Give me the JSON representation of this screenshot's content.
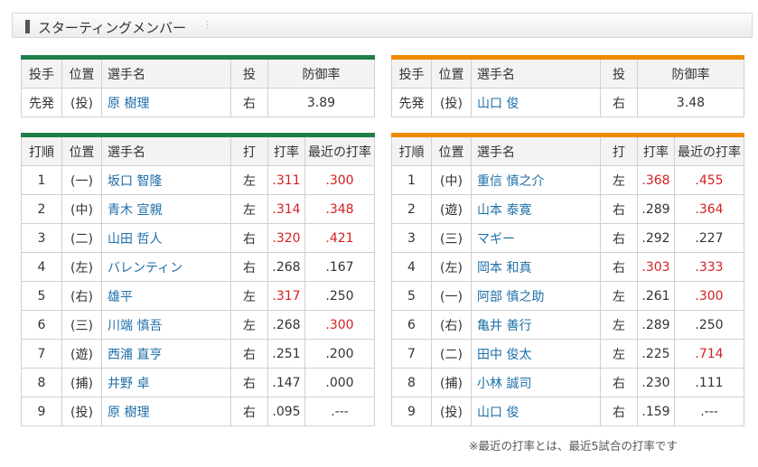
{
  "header": {
    "title": "スターティングメンバー",
    "dots": "⋮"
  },
  "pitcher_headers": [
    "投手",
    "位置",
    "選手名",
    "投",
    "防御率"
  ],
  "batter_headers": [
    "打順",
    "位置",
    "選手名",
    "打",
    "打率",
    "最近の打率"
  ],
  "left_team": {
    "color": "#1f7f4a",
    "pitcher": {
      "role": "先発",
      "pos": "(投)",
      "name": "原 樹理",
      "hand": "右",
      "era": "3.89"
    },
    "batters": [
      {
        "order": "1",
        "pos": "(一)",
        "name": "坂口 智隆",
        "hand": "左",
        "avg": ".311",
        "recent": ".300",
        "avg_red": true,
        "recent_red": true
      },
      {
        "order": "2",
        "pos": "(中)",
        "name": "青木 宣親",
        "hand": "左",
        "avg": ".314",
        "recent": ".348",
        "avg_red": true,
        "recent_red": true
      },
      {
        "order": "3",
        "pos": "(二)",
        "name": "山田 哲人",
        "hand": "右",
        "avg": ".320",
        "recent": ".421",
        "avg_red": true,
        "recent_red": true
      },
      {
        "order": "4",
        "pos": "(左)",
        "name": "バレンティン",
        "hand": "右",
        "avg": ".268",
        "recent": ".167",
        "avg_red": false,
        "recent_red": false
      },
      {
        "order": "5",
        "pos": "(右)",
        "name": "雄平",
        "hand": "左",
        "avg": ".317",
        "recent": ".250",
        "avg_red": true,
        "recent_red": false
      },
      {
        "order": "6",
        "pos": "(三)",
        "name": "川端 慎吾",
        "hand": "左",
        "avg": ".268",
        "recent": ".300",
        "avg_red": false,
        "recent_red": true
      },
      {
        "order": "7",
        "pos": "(遊)",
        "name": "西浦 直亨",
        "hand": "右",
        "avg": ".251",
        "recent": ".200",
        "avg_red": false,
        "recent_red": false
      },
      {
        "order": "8",
        "pos": "(捕)",
        "name": "井野 卓",
        "hand": "右",
        "avg": ".147",
        "recent": ".000",
        "avg_red": false,
        "recent_red": false
      },
      {
        "order": "9",
        "pos": "(投)",
        "name": "原 樹理",
        "hand": "右",
        "avg": ".095",
        "recent": ".---",
        "avg_red": false,
        "recent_red": false
      }
    ]
  },
  "right_team": {
    "color": "#f08a00",
    "pitcher": {
      "role": "先発",
      "pos": "(投)",
      "name": "山口 俊",
      "hand": "右",
      "era": "3.48"
    },
    "batters": [
      {
        "order": "1",
        "pos": "(中)",
        "name": "重信 慎之介",
        "hand": "左",
        "avg": ".368",
        "recent": ".455",
        "avg_red": true,
        "recent_red": true
      },
      {
        "order": "2",
        "pos": "(遊)",
        "name": "山本 泰寛",
        "hand": "右",
        "avg": ".289",
        "recent": ".364",
        "avg_red": false,
        "recent_red": true
      },
      {
        "order": "3",
        "pos": "(三)",
        "name": "マギー",
        "hand": "右",
        "avg": ".292",
        "recent": ".227",
        "avg_red": false,
        "recent_red": false
      },
      {
        "order": "4",
        "pos": "(左)",
        "name": "岡本 和真",
        "hand": "右",
        "avg": ".303",
        "recent": ".333",
        "avg_red": true,
        "recent_red": true
      },
      {
        "order": "5",
        "pos": "(一)",
        "name": "阿部 慎之助",
        "hand": "左",
        "avg": ".261",
        "recent": ".300",
        "avg_red": false,
        "recent_red": true
      },
      {
        "order": "6",
        "pos": "(右)",
        "name": "亀井 善行",
        "hand": "左",
        "avg": ".289",
        "recent": ".250",
        "avg_red": false,
        "recent_red": false
      },
      {
        "order": "7",
        "pos": "(二)",
        "name": "田中 俊太",
        "hand": "左",
        "avg": ".225",
        "recent": ".714",
        "avg_red": false,
        "recent_red": true
      },
      {
        "order": "8",
        "pos": "(捕)",
        "name": "小林 誠司",
        "hand": "右",
        "avg": ".230",
        "recent": ".111",
        "avg_red": false,
        "recent_red": false
      },
      {
        "order": "9",
        "pos": "(投)",
        "name": "山口 俊",
        "hand": "右",
        "avg": ".159",
        "recent": ".---",
        "avg_red": false,
        "recent_red": false
      }
    ]
  },
  "note": "※最近の打率とは、最近5試合の打率です"
}
